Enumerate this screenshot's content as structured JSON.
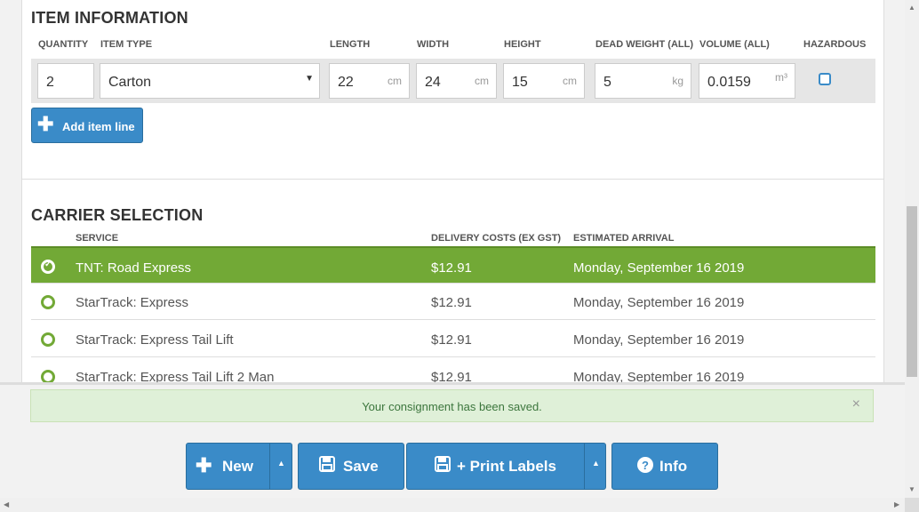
{
  "item_info": {
    "title": "ITEM INFORMATION",
    "columns": {
      "quantity": "QUANTITY",
      "item_type": "ITEM TYPE",
      "length": "LENGTH",
      "width": "WIDTH",
      "height": "HEIGHT",
      "dead_weight": "DEAD WEIGHT (ALL)",
      "volume": "VOLUME (ALL)",
      "hazardous": "HAZARDOUS"
    },
    "row": {
      "quantity": "2",
      "item_type": "Carton",
      "length": "22",
      "length_unit": "cm",
      "width": "24",
      "width_unit": "cm",
      "height": "15",
      "height_unit": "cm",
      "dead_weight": "5",
      "dead_weight_unit": "kg",
      "volume": "0.0159",
      "volume_unit": "m³",
      "hazardous": false
    },
    "add_label": "Add item line"
  },
  "carrier": {
    "title": "CARRIER SELECTION",
    "columns": {
      "service": "SERVICE",
      "cost": "DELIVERY COSTS (EX GST)",
      "eta": "ESTIMATED ARRIVAL"
    },
    "rows": [
      {
        "service": "TNT: Road Express",
        "cost": "$12.91",
        "eta": "Monday, September 16 2019",
        "selected": true
      },
      {
        "service": "StarTrack: Express",
        "cost": "$12.91",
        "eta": "Monday, September 16 2019",
        "selected": false
      },
      {
        "service": "StarTrack: Express Tail Lift",
        "cost": "$12.91",
        "eta": "Monday, September 16 2019",
        "selected": false
      },
      {
        "service": "StarTrack: Express Tail Lift 2 Man",
        "cost": "$12.91",
        "eta": "Monday, September 16 2019",
        "selected": false
      }
    ]
  },
  "alert": {
    "message": "Your consignment has been saved.",
    "close": "×"
  },
  "actions": {
    "new_label": "New",
    "save_label": "Save",
    "print_label": "+ Print Labels",
    "info_label": "Info"
  },
  "colors": {
    "primary": "#3a8bc8",
    "selected_row": "#72a936",
    "alert_bg": "#dff0d8",
    "alert_text": "#3c763d"
  }
}
